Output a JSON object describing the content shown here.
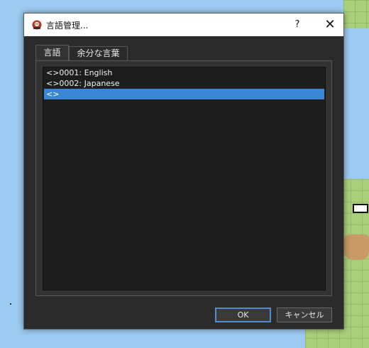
{
  "window": {
    "title": "言語管理...",
    "help_label": "?",
    "close_label": "✕"
  },
  "tabs": [
    {
      "label": "言語",
      "selected": true
    },
    {
      "label": "余分な言葉",
      "selected": false
    }
  ],
  "language_list": {
    "items": [
      {
        "label": "<>0001: English",
        "selected": false
      },
      {
        "label": "<>0002: Japanese",
        "selected": false
      },
      {
        "label": "<>",
        "selected": true
      }
    ]
  },
  "buttons": {
    "ok_label": "OK",
    "cancel_label": "キャンセル"
  },
  "colors": {
    "selection": "#3a87d6",
    "dialog_bg": "#2b2b2b",
    "list_bg": "#1d1d1d",
    "default_button_border": "#4f8ed3"
  },
  "icons": {
    "app": "rpg-maker-app-icon",
    "help": "question-mark-icon",
    "close": "close-x-icon"
  }
}
